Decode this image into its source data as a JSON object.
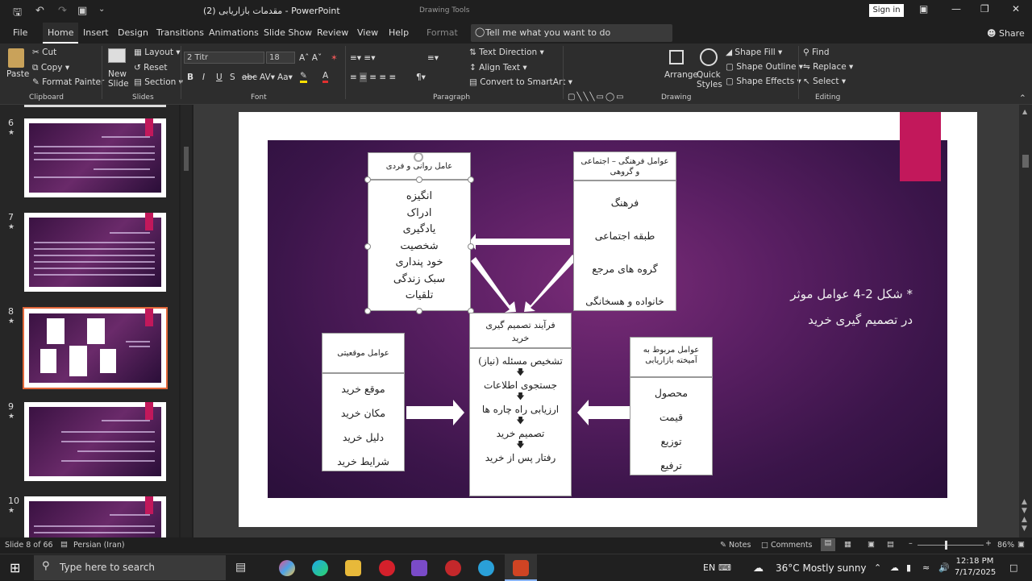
{
  "titlebar": {
    "title": "مقدمات بازاریابی (2)  -  PowerPoint",
    "drawing_tools": "Drawing Tools",
    "signin": "Sign in"
  },
  "tabs": [
    "File",
    "Home",
    "Insert",
    "Design",
    "Transitions",
    "Animations",
    "Slide Show",
    "Review",
    "View",
    "Help",
    "Format"
  ],
  "tell_me": "Tell me what you want to do",
  "share": "Share",
  "ribbon": {
    "paste": "Paste",
    "cut": "Cut",
    "copy": "Copy",
    "format_painter": "Format Painter",
    "clipboard": "Clipboard",
    "new_slide": "New Slide",
    "layout": "Layout",
    "reset": "Reset",
    "section": "Section",
    "slides": "Slides",
    "font_name": "2  Titr",
    "font_size": "18",
    "font": "Font",
    "paragraph": "Paragraph",
    "text_direction": "Text Direction",
    "align_text": "Align Text",
    "convert_smartart": "Convert to SmartArt",
    "arrange": "Arrange",
    "quick_styles": "Quick Styles",
    "shape_fill": "Shape Fill",
    "shape_outline": "Shape Outline",
    "shape_effects": "Shape Effects",
    "drawing": "Drawing",
    "find": "Find",
    "replace": "Replace",
    "select": "Select",
    "editing": "Editing"
  },
  "thumbnails": [
    {
      "num": "6"
    },
    {
      "num": "7"
    },
    {
      "num": "8"
    },
    {
      "num": "9"
    },
    {
      "num": "10"
    }
  ],
  "slide": {
    "psych_header": "عامل روانی و فردی",
    "psych_items": [
      "انگیزه",
      "ادراک",
      "یادگیری",
      "شخصیت",
      "خود پنداری",
      "سبک زندگی",
      "تلقیات"
    ],
    "cultural_header": "عوامل فرهنگی – اجتماعی و گروهی",
    "cultural_items": [
      "فرهنگ",
      "طبقه اجتماعی",
      "گروه های مرجع",
      "خانواده و هسخانگی"
    ],
    "process_header": "فرآیند تصمیم گیری خرید",
    "process_items": [
      "تشخیص مسئله (نیاز)",
      "جستجوی اطلاعات",
      "ارزیابی راه چاره ها",
      "تصمیم خرید",
      "رفتار پس از خرید"
    ],
    "situational_header": "عوامل موقعیتی",
    "situational_items": [
      "موقع خرید",
      "مکان خرید",
      "دلیل خرید",
      "شرایط خرید"
    ],
    "marketing_header": "عوامل مربوط به آمیخته بازاریابی",
    "marketing_items": [
      "محصول",
      "قیمت",
      "توزیع",
      "ترفیع"
    ],
    "caption_line1": "* شکل 2-4 عوامل موثر",
    "caption_line2": "در تصمیم گیری خرید"
  },
  "status": {
    "slide_info": "Slide 8 of 66",
    "language": "Persian (Iran)",
    "notes": "Notes",
    "comments": "Comments",
    "zoom": "86%"
  },
  "taskbar": {
    "search": "Type here to search",
    "lang": "EN",
    "weather": "36°C  Mostly sunny",
    "time": "12:18 PM",
    "date": "7/17/2025"
  },
  "colors": {
    "accent_pink": "#c2185b",
    "selection": "#e2673a"
  }
}
